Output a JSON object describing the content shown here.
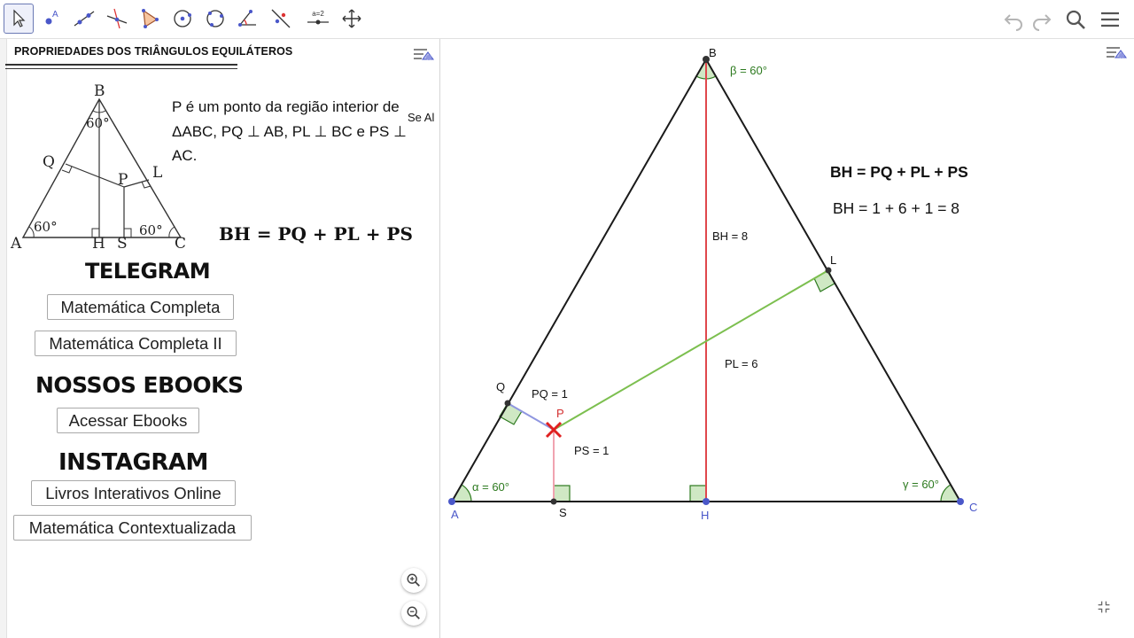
{
  "toolbar": {
    "tools": [
      "move-tool",
      "point-tool",
      "line-tool",
      "perpendicular-line-tool",
      "polygon-tool",
      "circle-center-point-tool",
      "circle-three-points-tool",
      "angle-tool",
      "reflect-tool",
      "slider-tool",
      "move-graphics-view-tool"
    ],
    "slider_label": "a=2"
  },
  "left_panel": {
    "title": "PROPRIEDADES DOS TRIÂNGULOS EQUILÁTEROS",
    "figure": {
      "vertex_b": "B",
      "vertex_a": "A",
      "vertex_c": "C",
      "point_q": "Q",
      "point_p": "P",
      "point_l": "L",
      "point_h": "H",
      "point_s": "S",
      "angle_top": "60°",
      "angle_left": "60°",
      "angle_right": "60°"
    },
    "description": "P é um ponto da região interior de ΔABC, PQ ⊥ AB, PL ⊥ BC e PS ⊥ AC.",
    "truncated_text": "Se Al",
    "formula": "BH = PQ + PL + PS",
    "headings": {
      "telegram": "TELEGRAM",
      "ebooks": "NOSSOS EBOOKS",
      "instagram": "INSTAGRAM"
    },
    "buttons": {
      "telegram1": "Matemática Completa",
      "telegram2": "Matemática Completa II",
      "ebooks": "Acessar Ebooks",
      "instagram1": "Livros Interativos Online",
      "instagram2": "Matemática Contextualizada"
    }
  },
  "canvas": {
    "points": {
      "A": "A",
      "B": "B",
      "C": "C",
      "H": "H",
      "Q": "Q",
      "L": "L",
      "P": "P",
      "S": "S"
    },
    "angles": {
      "alpha": "α = 60°",
      "beta": "β = 60°",
      "gamma": "γ = 60°"
    },
    "segments": {
      "bh": "BH = 8",
      "pl": "PL = 6",
      "pq": "PQ = 1",
      "ps": "PS = 1"
    },
    "formula_bold": "BH = PQ + PL + PS",
    "formula_values": "BH = 1 + 6 + 1 = 8"
  },
  "colors": {
    "triangle": "#1a1a1a",
    "height": "#e0474c",
    "pl_segment": "#7cbf4f",
    "pq_segment": "#8f96e0",
    "ps_segment": "#f0a3b0",
    "angle_fill": "#cfe8c4",
    "angle_stroke": "#2d7a1f",
    "point_blue": "#4a57c9",
    "point_red": "#e02020"
  }
}
